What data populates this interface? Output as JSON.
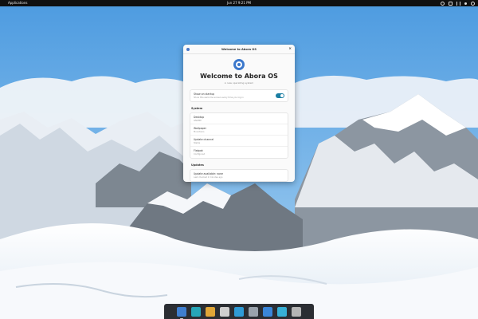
{
  "topbar": {
    "apps_label": "Applications",
    "clock": "Jun 27  9:21 PM",
    "tray_icons": [
      "accessibility-icon",
      "keyboard-icon",
      "network-icon",
      "audio-icon",
      "power-icon"
    ]
  },
  "window": {
    "title": "Welcome to Abora OS",
    "close_glyph": "×",
    "heading": "Welcome to Abora OS",
    "subtitle": "A new operating system",
    "startup": {
      "label": "Show on startup",
      "description": "Show this welcome screen every time you log in",
      "enabled": true
    },
    "system_section": "System",
    "system_items": [
      {
        "title": "Desktop",
        "value": "GNOME"
      },
      {
        "title": "Wallpaper",
        "value": "Mountains"
      },
      {
        "title": "Update channel",
        "value": "Stable"
      },
      {
        "title": "Flatpak",
        "value": "Configured"
      }
    ],
    "updates_section": "Updates",
    "updates_items": [
      {
        "title": "Update available: none",
        "value": "Last checked 2 minutes ago"
      }
    ]
  },
  "dock": {
    "items": [
      {
        "name": "files-app",
        "color": "#3f7fd0",
        "running": true
      },
      {
        "name": "terminal-app",
        "color": "#27a6b8",
        "running": false
      },
      {
        "name": "grid-app",
        "color": "#e0a637",
        "running": false
      },
      {
        "name": "settings-app",
        "color": "#cfcfcf",
        "running": false
      },
      {
        "name": "folder-app",
        "color": "#2f9bd6",
        "running": false
      },
      {
        "name": "calendar-app",
        "color": "#9aa3ad",
        "running": false
      },
      {
        "name": "browser-app",
        "color": "#3a86d9",
        "running": false
      },
      {
        "name": "store-app",
        "color": "#37b0d6",
        "running": false
      },
      {
        "name": "trash-app",
        "color": "#b5b5b5",
        "running": false
      }
    ]
  },
  "colors": {
    "accent": "#1c7fa3",
    "dock_bg": "#2b2e33",
    "topbar_bg": "#101010"
  }
}
